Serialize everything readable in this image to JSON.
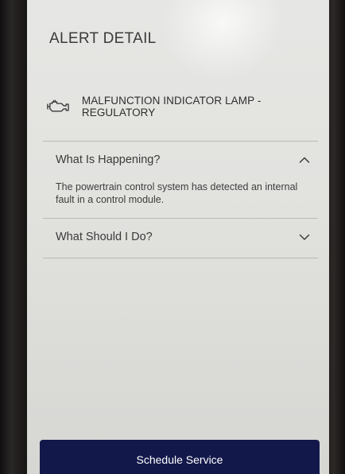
{
  "page": {
    "title": "ALERT DETAIL"
  },
  "alert": {
    "icon": "engine-icon",
    "title": "MALFUNCTION INDICATOR LAMP - REGULATORY"
  },
  "sections": [
    {
      "title": "What Is Happening?",
      "expanded": true,
      "icon": "chevron-up-icon",
      "body": "The powertrain control system has detected an internal fault in a control module."
    },
    {
      "title": "What Should I Do?",
      "expanded": false,
      "icon": "chevron-down-icon"
    }
  ],
  "actions": {
    "primary_label": "Schedule Service"
  },
  "colors": {
    "primary_button": "#12184a",
    "text": "#3a3a3a",
    "divider": "#b9b9b6"
  }
}
